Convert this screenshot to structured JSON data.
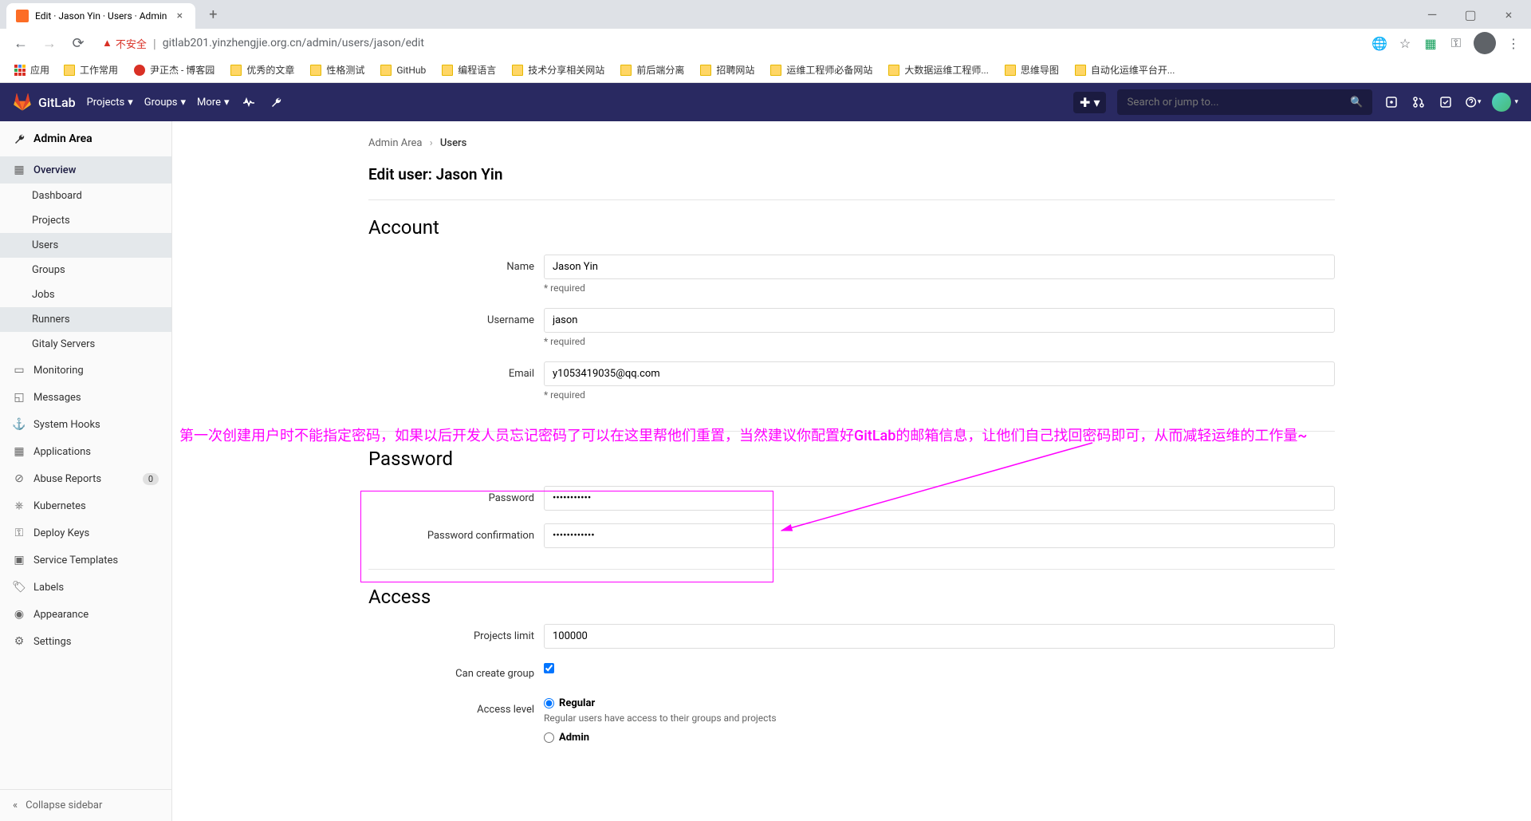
{
  "browser": {
    "tab_title": "Edit · Jason Yin · Users · Admin",
    "url": "gitlab201.yinzhengjie.org.cn/admin/users/jason/edit",
    "warning_text": "不安全",
    "apps_label": "应用",
    "bookmarks": [
      "工作常用",
      "尹正杰 - 博客园",
      "优秀的文章",
      "性格测试",
      "GitHub",
      "编程语言",
      "技术分享相关网站",
      "前后端分离",
      "招聘网站",
      "运维工程师必备网站",
      "大数据运维工程师...",
      "思维导图",
      "自动化运维平台开..."
    ]
  },
  "header": {
    "brand": "GitLab",
    "nav": {
      "projects": "Projects",
      "groups": "Groups",
      "more": "More"
    },
    "search_placeholder": "Search or jump to..."
  },
  "sidebar": {
    "title": "Admin Area",
    "overview": "Overview",
    "sub": {
      "dashboard": "Dashboard",
      "projects": "Projects",
      "users": "Users",
      "groups": "Groups",
      "jobs": "Jobs",
      "runners": "Runners",
      "gitaly": "Gitaly Servers"
    },
    "monitoring": "Monitoring",
    "messages": "Messages",
    "system_hooks": "System Hooks",
    "applications": "Applications",
    "abuse": "Abuse Reports",
    "abuse_count": "0",
    "kubernetes": "Kubernetes",
    "deploy_keys": "Deploy Keys",
    "service_templates": "Service Templates",
    "labels": "Labels",
    "appearance": "Appearance",
    "settings": "Settings",
    "collapse": "Collapse sidebar"
  },
  "breadcrumb": {
    "admin": "Admin Area",
    "users": "Users"
  },
  "page": {
    "title": "Edit user: Jason Yin"
  },
  "account": {
    "section_title": "Account",
    "name_label": "Name",
    "name_value": "Jason Yin",
    "name_help": "* required",
    "username_label": "Username",
    "username_value": "jason",
    "username_help": "* required",
    "email_label": "Email",
    "email_value": "y1053419035@qq.com",
    "email_help": "* required"
  },
  "password": {
    "section_title": "Password",
    "password_label": "Password",
    "password_value": "•••••••••••",
    "confirm_label": "Password confirmation",
    "confirm_value": "••••••••••••"
  },
  "access": {
    "section_title": "Access",
    "limit_label": "Projects limit",
    "limit_value": "100000",
    "create_group_label": "Can create group",
    "level_label": "Access level",
    "regular_label": "Regular",
    "regular_help": "Regular users have access to their groups and projects",
    "admin_label": "Admin"
  },
  "annotation": {
    "text": "第一次创建用户时不能指定密码，如果以后开发人员忘记密码了可以在这里帮他们重置，当然建议你配置好GitLab的邮箱信息，让他们自己找回密码即可，从而减轻运维的工作量~"
  }
}
